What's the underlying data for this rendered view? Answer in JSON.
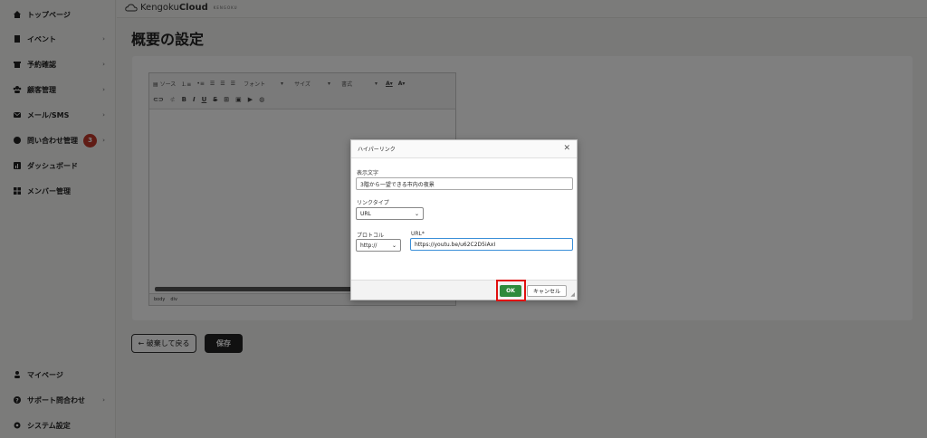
{
  "topbar": {
    "brand_regular": "Kengoku",
    "brand_bold": "Cloud",
    "tagline": "KENGOKU"
  },
  "sidebar": {
    "items": [
      {
        "label": "トップページ"
      },
      {
        "label": "イベント"
      },
      {
        "label": "予約確認"
      },
      {
        "label": "顧客管理"
      },
      {
        "label": "メール/SMS"
      },
      {
        "label": "問い合わせ管理",
        "badge": "3"
      },
      {
        "label": "ダッシュボード"
      },
      {
        "label": "メンバー管理"
      }
    ],
    "bottom_items": [
      {
        "label": "マイページ"
      },
      {
        "label": "サポート問合わせ"
      },
      {
        "label": "システム設定"
      }
    ],
    "chevron": "›"
  },
  "page": {
    "title": "概要の設定"
  },
  "editor": {
    "row1": {
      "source": "ソース",
      "font": "フォント",
      "size": "サイズ",
      "format": "書式",
      "text_color": "A",
      "bg_color": "A"
    },
    "row2": {
      "bold": "B",
      "italic": "I",
      "underline": "U",
      "strike": "S"
    },
    "path": [
      "body",
      "div"
    ]
  },
  "actions": {
    "back_label": "← 破棄して戻る",
    "save_label": "保存"
  },
  "dialog": {
    "title": "ハイパーリンク",
    "close": "✕",
    "display_text_label": "表示文字",
    "display_text_value": "3階から一望できる市内の夜景",
    "link_type_label": "リンクタイプ",
    "link_type_value": "URL",
    "protocol_label": "プロトコル",
    "protocol_value": "http://",
    "url_label": "URL*",
    "url_value": "https://youtu.be/u62C2D5iAxI",
    "ok_label": "OK",
    "cancel_label": "キャンセル"
  },
  "colors": {
    "ok_green": "#2e8b3c",
    "highlight_red": "#e01010",
    "badge_red": "#c0392b"
  }
}
